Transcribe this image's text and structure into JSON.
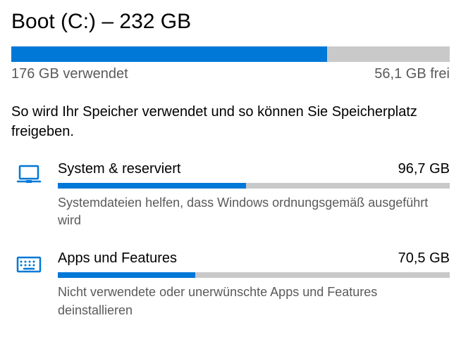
{
  "drive": {
    "title": "Boot (C:) – 232 GB",
    "used_label": "176 GB verwendet",
    "free_label": "56,1 GB frei",
    "fill_percent": "72%"
  },
  "description": "So wird Ihr Speicher verwendet und so können Sie Speicherplatz freigeben.",
  "categories": [
    {
      "name": "System & reserviert",
      "size": "96,7 GB",
      "desc": "Systemdateien helfen, dass Windows ordnungsgemäß ausgeführt wird",
      "fill_percent": "48%"
    },
    {
      "name": "Apps und Features",
      "size": "70,5 GB",
      "desc": "Nicht verwendete oder unerwünschte Apps und Features deinstallieren",
      "fill_percent": "35%"
    }
  ]
}
